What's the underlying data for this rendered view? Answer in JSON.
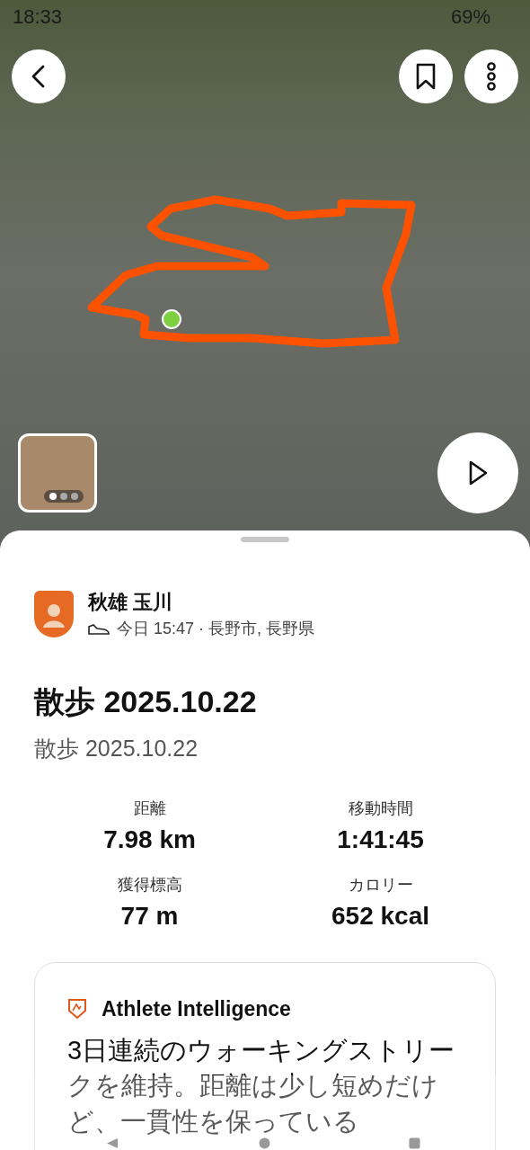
{
  "status_bar": {
    "time": "18:33",
    "battery": "69%"
  },
  "thumbnail": {
    "dots": [
      {
        "selected": true
      },
      {
        "selected": false
      },
      {
        "selected": false
      }
    ]
  },
  "athlete": {
    "name": "秋雄 玉川",
    "meta": "今日 15:47 · 長野市, 長野県"
  },
  "activity": {
    "title": "散歩 2025.10.22",
    "subtitle": "散歩 2025.10.22"
  },
  "stats": [
    {
      "label": "距離",
      "value": "7.98 km"
    },
    {
      "label": "移動時間",
      "value": "1:41:45"
    },
    {
      "label": "獲得標高",
      "value": "77 m"
    },
    {
      "label": "カロリー",
      "value": "652 kcal"
    }
  ],
  "insight": {
    "title": "Athlete Intelligence",
    "text": "3日連続のウォーキングストリークを維持。距離は少し短めだけど、一貫性を保っている"
  }
}
